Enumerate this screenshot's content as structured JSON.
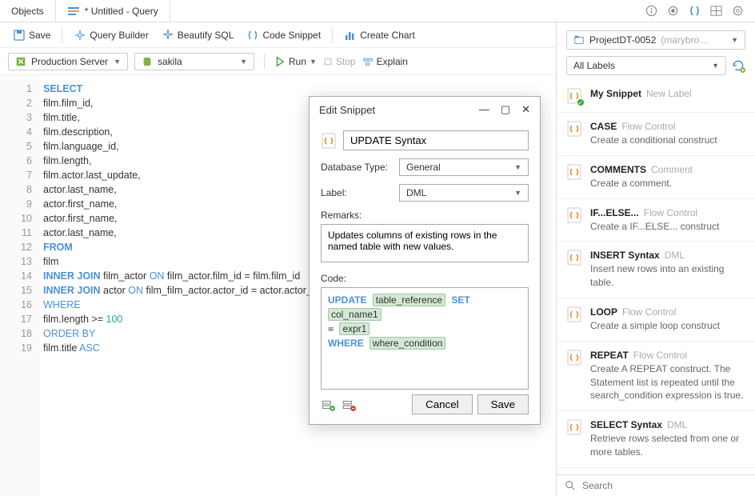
{
  "tabs": {
    "objects": "Objects",
    "query": "* Untitled - Query"
  },
  "toolbar": {
    "save": "Save",
    "query_builder": "Query Builder",
    "beautify": "Beautify SQL",
    "snippet": "Code Snippet",
    "chart": "Create Chart"
  },
  "toolbar2": {
    "server": "Production Server",
    "database": "sakila",
    "run": "Run",
    "stop": "Stop",
    "explain": "Explain"
  },
  "code_lines": [
    {
      "n": 1,
      "html": "<span class='kw'>SELECT</span>"
    },
    {
      "n": 2,
      "html": "film.film_id,"
    },
    {
      "n": 3,
      "html": "film.title,"
    },
    {
      "n": 4,
      "html": "film.description,"
    },
    {
      "n": 5,
      "html": "film.language_id,"
    },
    {
      "n": 6,
      "html": "film.length,"
    },
    {
      "n": 7,
      "html": "film.actor.last_update,"
    },
    {
      "n": 8,
      "html": "actor.last_name,"
    },
    {
      "n": 9,
      "html": "actor.first_name,"
    },
    {
      "n": 10,
      "html": "actor.first_name,"
    },
    {
      "n": 11,
      "html": "actor.last_name,"
    },
    {
      "n": 12,
      "html": "<span class='kw'>FROM</span>"
    },
    {
      "n": 13,
      "html": "film"
    },
    {
      "n": 14,
      "html": "<span class='kw'>INNER JOIN</span> film_actor <span class='kw2'>ON</span> film_actor.film_id = film.film_id"
    },
    {
      "n": 15,
      "html": "<span class='kw'>INNER JOIN</span> actor <span class='kw2'>ON</span> film_film_actor.actor_id = actor.actor_id"
    },
    {
      "n": 16,
      "html": "<span class='kw2'>WHERE</span>"
    },
    {
      "n": 17,
      "html": "film.length &gt;= <span class='num'>100</span>"
    },
    {
      "n": 18,
      "html": "<span class='kw2'>ORDER BY</span>"
    },
    {
      "n": 19,
      "html": "film.title <span class='kw2'>ASC</span>"
    }
  ],
  "right": {
    "project": "ProjectDT-0052",
    "project_user": "(marybro…",
    "labels": "All Labels"
  },
  "snippets": [
    {
      "title": "My Snippet",
      "cat": "New Label",
      "desc": "",
      "check": true
    },
    {
      "title": "CASE",
      "cat": "Flow Control",
      "desc": "Create a conditional construct"
    },
    {
      "title": "COMMENTS",
      "cat": "Comment",
      "desc": "Create a comment."
    },
    {
      "title": "IF...ELSE...",
      "cat": "Flow Control",
      "desc": "Create a IF...ELSE... construct"
    },
    {
      "title": "INSERT Syntax",
      "cat": "DML",
      "desc": "Insert new rows into an existing table."
    },
    {
      "title": "LOOP",
      "cat": "Flow Control",
      "desc": "Create a simple loop construct"
    },
    {
      "title": "REPEAT",
      "cat": "Flow Control",
      "desc": "Create A REPEAT construct. The Statement list is repeated until the search_condition expression is true."
    },
    {
      "title": "SELECT Syntax",
      "cat": "DML",
      "desc": "Retrieve rows selected from one or more tables."
    }
  ],
  "search_placeholder": "Search",
  "dialog": {
    "title": "Edit Snippet",
    "name": "UPDATE Syntax",
    "db_type_label": "Database Type:",
    "db_type": "General",
    "label_label": "Label:",
    "label": "DML",
    "remarks_label": "Remarks:",
    "remarks": "Updates columns of existing rows in the named table with new values.",
    "code_label": "Code:",
    "cancel": "Cancel",
    "save": "Save"
  }
}
